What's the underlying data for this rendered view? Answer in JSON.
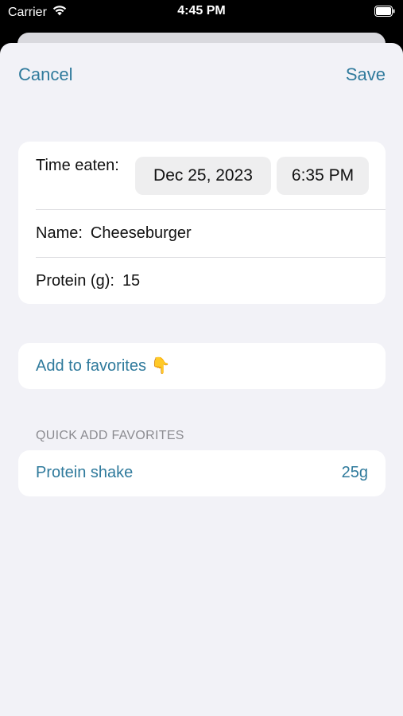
{
  "status_bar": {
    "carrier": "Carrier",
    "time": "4:45 PM"
  },
  "nav": {
    "cancel_label": "Cancel",
    "save_label": "Save"
  },
  "form": {
    "time_label": "Time eaten:",
    "date_value": "Dec 25, 2023",
    "time_value": "6:35 PM",
    "name_label": "Name:",
    "name_value": "Cheeseburger",
    "protein_label": "Protein (g):",
    "protein_value": "15"
  },
  "favorites": {
    "add_label": "Add to favorites",
    "add_emoji": "👇"
  },
  "quick_add": {
    "header": "QUICK ADD FAVORITES",
    "items": [
      {
        "name": "Protein shake",
        "amount": "25g"
      }
    ]
  },
  "colors": {
    "accent": "#2f7a9c",
    "background": "#f2f2f7",
    "card": "#ffffff"
  },
  "icons": [
    "wifi-icon",
    "battery-icon"
  ]
}
